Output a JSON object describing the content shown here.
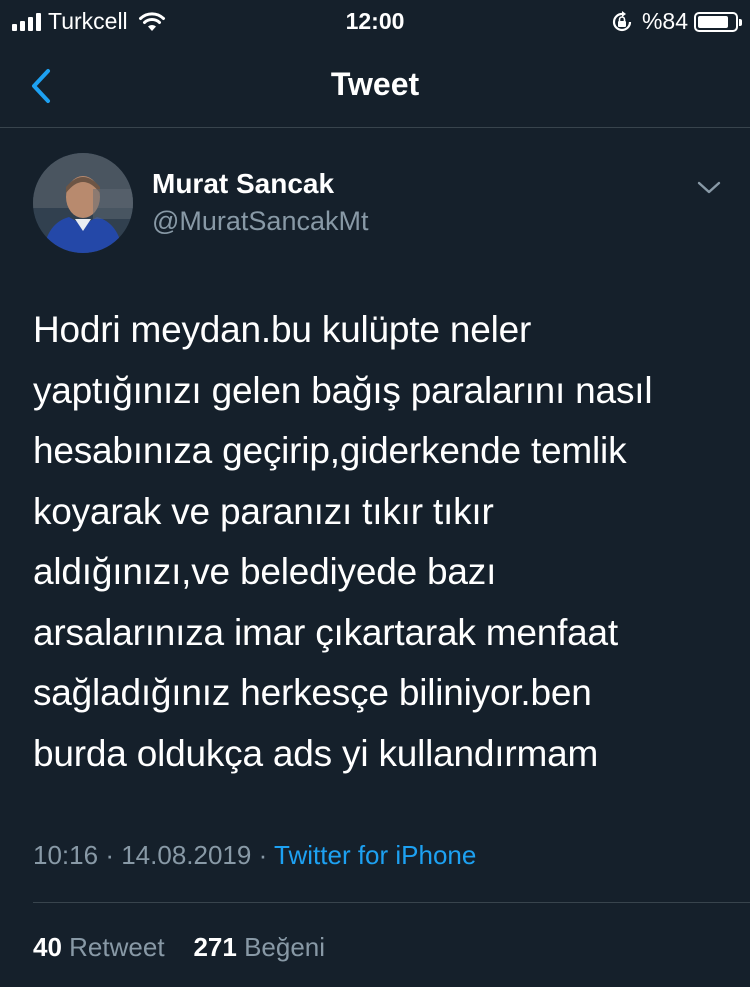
{
  "status_bar": {
    "carrier": "Turkcell",
    "time": "12:00",
    "battery": "%84",
    "battery_level": 0.84,
    "icons": [
      "signal-icon",
      "wifi-icon",
      "orientation-lock-icon",
      "battery-icon"
    ]
  },
  "navbar": {
    "title": "Tweet",
    "back_icon": "chevron-left-icon"
  },
  "tweet": {
    "author_name": "Murat Sancak",
    "author_handle": "@MuratSancakMt",
    "text": "Hodri meydan.bu kulüpte neler\nyaptığınızı gelen bağış paralarını nasıl\nhesabınıza geçirip,giderkende  temlik\nkoyarak ve paranızı tıkır tıkır\naldığınızı,ve belediyede bazı\narsalarınıza imar çıkartarak menfaat\nsağladığınız herkesçe biliniyor.ben\nburda oldukça ads yi kullandırmam",
    "time": "10:16",
    "separator": "·",
    "date": "14.08.2019",
    "source": "Twitter for iPhone",
    "retweet_count": "40",
    "retweet_label": "Retweet",
    "like_count": "271",
    "like_label": "Beğeni"
  },
  "colors": {
    "background": "#15202b",
    "accent": "#1da1f2",
    "secondary_text": "#8899a6",
    "divider": "#38444d"
  }
}
